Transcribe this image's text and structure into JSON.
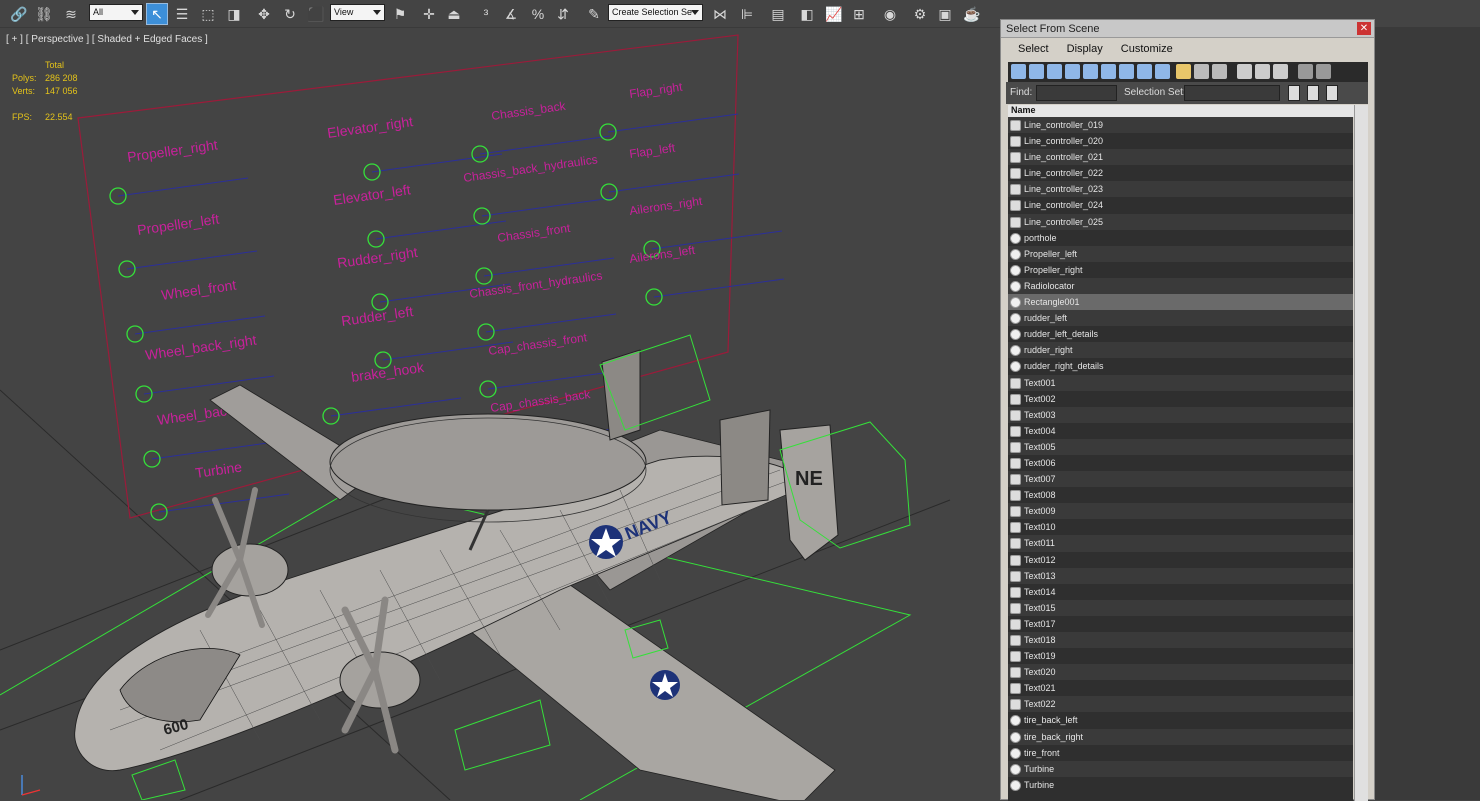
{
  "toolbar": {
    "selection_filter": "All",
    "ref_coord": "View",
    "named_selection_placeholder": "Create Selection Se"
  },
  "viewport": {
    "label": "[ + ] [ Perspective ] [ Shaded + Edged Faces ]",
    "stats": {
      "header": "Total",
      "polys_label": "Polys:",
      "polys_value": "286 208",
      "verts_label": "Verts:",
      "verts_value": "147 056",
      "fps_label": "FPS:",
      "fps_value": "22.554"
    },
    "controller_labels": [
      "Propeller_right",
      "Propeller_left",
      "Wheel_front",
      "Wheel_back_right",
      "Wheel_back_left",
      "Turbine",
      "Elevator_right",
      "Elevator_left",
      "Rudder_right",
      "Rudder_left",
      "brake_hook",
      "Chassis_back",
      "Chassis_back_hydraulics",
      "Chassis_front",
      "Chassis_front_hydraulics",
      "Cap_chassis_front",
      "Cap_chassis_back",
      "Flap_right",
      "Flap_left",
      "Ailerons_right",
      "Ailerons_left"
    ],
    "aircraft_marking_navy": "NAVY",
    "aircraft_marking_tail": "NE",
    "aircraft_marking_number": "600",
    "colors": {
      "controller_text": "#c8219b",
      "helper_green": "#35e03a",
      "panel_frame": "#9b1b3a"
    }
  },
  "dialog": {
    "title": "Select From Scene",
    "menu": [
      "Select",
      "Display",
      "Customize"
    ],
    "find_label": "Find:",
    "selection_set_label": "Selection Set:",
    "column_name": "Name",
    "items": [
      {
        "name": "Line_controller_019",
        "icon": "group-icon"
      },
      {
        "name": "Line_controller_020",
        "icon": "group-icon"
      },
      {
        "name": "Line_controller_021",
        "icon": "group-icon"
      },
      {
        "name": "Line_controller_022",
        "icon": "group-icon"
      },
      {
        "name": "Line_controller_023",
        "icon": "group-icon"
      },
      {
        "name": "Line_controller_024",
        "icon": "group-icon"
      },
      {
        "name": "Line_controller_025",
        "icon": "group-icon"
      },
      {
        "name": "porthole",
        "icon": "geometry-icon"
      },
      {
        "name": "Propeller_left",
        "icon": "geometry-icon"
      },
      {
        "name": "Propeller_right",
        "icon": "geometry-icon"
      },
      {
        "name": "Radiolocator",
        "icon": "geometry-icon"
      },
      {
        "name": "Rectangle001",
        "icon": "geometry-icon",
        "selected": true
      },
      {
        "name": "rudder_left",
        "icon": "geometry-icon"
      },
      {
        "name": "rudder_left_details",
        "icon": "geometry-icon"
      },
      {
        "name": "rudder_right",
        "icon": "geometry-icon"
      },
      {
        "name": "rudder_right_details",
        "icon": "geometry-icon"
      },
      {
        "name": "Text001",
        "icon": "group-icon"
      },
      {
        "name": "Text002",
        "icon": "group-icon"
      },
      {
        "name": "Text003",
        "icon": "group-icon"
      },
      {
        "name": "Text004",
        "icon": "group-icon"
      },
      {
        "name": "Text005",
        "icon": "group-icon"
      },
      {
        "name": "Text006",
        "icon": "group-icon"
      },
      {
        "name": "Text007",
        "icon": "group-icon"
      },
      {
        "name": "Text008",
        "icon": "group-icon"
      },
      {
        "name": "Text009",
        "icon": "group-icon"
      },
      {
        "name": "Text010",
        "icon": "group-icon"
      },
      {
        "name": "Text011",
        "icon": "group-icon"
      },
      {
        "name": "Text012",
        "icon": "group-icon"
      },
      {
        "name": "Text013",
        "icon": "group-icon"
      },
      {
        "name": "Text014",
        "icon": "group-icon"
      },
      {
        "name": "Text015",
        "icon": "group-icon"
      },
      {
        "name": "Text017",
        "icon": "group-icon"
      },
      {
        "name": "Text018",
        "icon": "group-icon"
      },
      {
        "name": "Text019",
        "icon": "group-icon"
      },
      {
        "name": "Text020",
        "icon": "group-icon"
      },
      {
        "name": "Text021",
        "icon": "group-icon"
      },
      {
        "name": "Text022",
        "icon": "group-icon"
      },
      {
        "name": "tire_back_left",
        "icon": "geometry-icon"
      },
      {
        "name": "tire_back_right",
        "icon": "geometry-icon"
      },
      {
        "name": "tire_front",
        "icon": "geometry-icon"
      },
      {
        "name": "Turbine",
        "icon": "geometry-icon"
      },
      {
        "name": "Turbine",
        "icon": "geometry-icon"
      }
    ]
  }
}
